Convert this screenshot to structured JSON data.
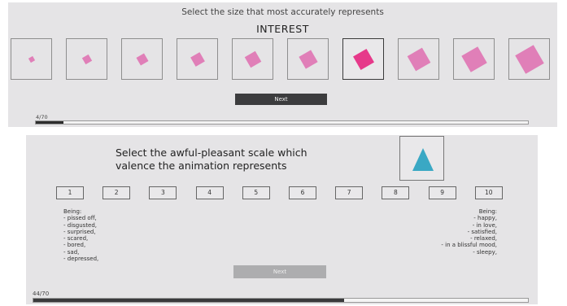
{
  "top": {
    "instruction": "Select the size that most accurately represents",
    "dimension": "INTEREST",
    "size_options": [
      {
        "relative_size": 0.18,
        "selected": false
      },
      {
        "relative_size": 0.24,
        "selected": false
      },
      {
        "relative_size": 0.3,
        "selected": false
      },
      {
        "relative_size": 0.36,
        "selected": false
      },
      {
        "relative_size": 0.42,
        "selected": false
      },
      {
        "relative_size": 0.47,
        "selected": false
      },
      {
        "relative_size": 0.52,
        "selected": true
      },
      {
        "relative_size": 0.58,
        "selected": false
      },
      {
        "relative_size": 0.65,
        "selected": false
      },
      {
        "relative_size": 0.72,
        "selected": false
      }
    ],
    "next_label": "Next",
    "progress_label": "4/70",
    "progress_fraction": 0.057,
    "colors": {
      "shape": "#e07fb8",
      "selected_shape": "#e6398a"
    }
  },
  "bottom": {
    "instruction_line1": "Select the awful-pleasant scale which",
    "instruction_line2": "valence the animation represents",
    "stimulus_icon": "triangle-icon",
    "stimulus_color": "#3aa8c4",
    "scale": [
      "1",
      "2",
      "3",
      "4",
      "5",
      "6",
      "7",
      "8",
      "9",
      "10"
    ],
    "left_desc": [
      "Being:",
      "- pissed off,",
      "- disgusted,",
      "- surprised,",
      "- scared,",
      "- bored,",
      "- sad,",
      "- depressed,"
    ],
    "right_desc": [
      "Being:",
      "- happy,",
      "- in love,",
      "- satisfied,",
      "- relaxed,",
      "- in a blissful mood,",
      "- sleepy,"
    ],
    "next_label": "Next",
    "progress_label": "44/70",
    "progress_fraction": 0.629
  }
}
